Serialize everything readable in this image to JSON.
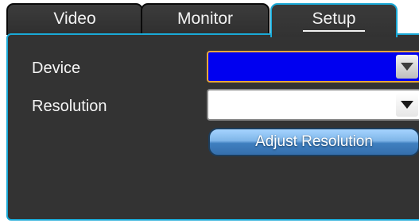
{
  "tabs": [
    {
      "label": "Video",
      "active": false
    },
    {
      "label": "Monitor",
      "active": false
    },
    {
      "label": "Setup",
      "active": true
    }
  ],
  "close_icon": "close-icon",
  "form": {
    "device_label": "Device",
    "device_value": "",
    "resolution_label": "Resolution",
    "resolution_value": "",
    "adjust_button": "Adjust Resolution"
  },
  "colors": {
    "panel_bg": "#333333",
    "accent_border": "#19a9d7",
    "focus_border": "#e7a63b",
    "device_select_bg": "#0000f0",
    "button_blue": "#5b9bd9"
  }
}
